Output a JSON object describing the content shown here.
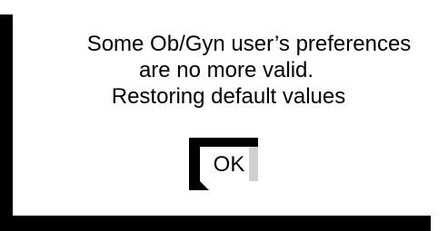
{
  "dialog": {
    "message_lines": [
      "Some Ob/Gyn user’s preferences",
      "are no more valid.",
      "Restoring default values"
    ],
    "ok_label": "OK"
  }
}
